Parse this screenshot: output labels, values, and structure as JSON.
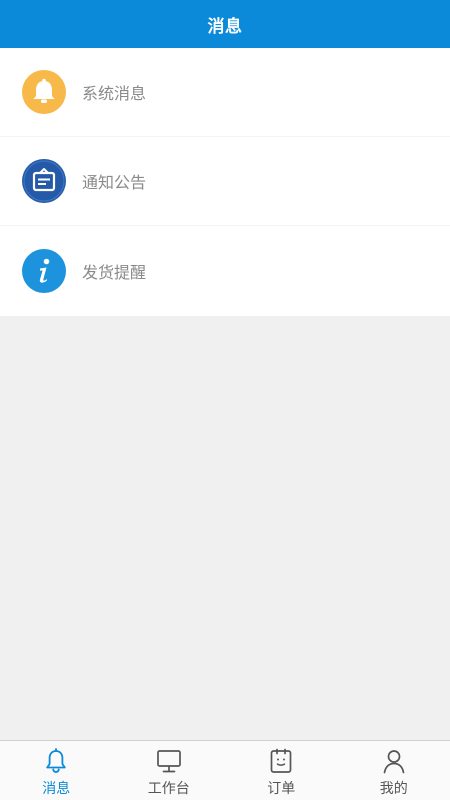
{
  "header": {
    "title": "消息",
    "color": "#0a8ad8"
  },
  "list": {
    "items": [
      {
        "label": "系统消息",
        "icon": "bell-icon",
        "icon_color": "#f7b94a"
      },
      {
        "label": "通知公告",
        "icon": "notice-board-icon",
        "icon_color": "#245aa7"
      },
      {
        "label": "发货提醒",
        "icon": "info-icon",
        "icon_color": "#1c93dc"
      }
    ]
  },
  "tabbar": {
    "active_color": "#0a8ad8",
    "inactive_color": "#555555",
    "tabs": [
      {
        "label": "消息",
        "icon": "bell-outline-icon",
        "active": true
      },
      {
        "label": "工作台",
        "icon": "monitor-icon",
        "active": false
      },
      {
        "label": "订单",
        "icon": "order-icon",
        "active": false
      },
      {
        "label": "我的",
        "icon": "user-icon",
        "active": false
      }
    ]
  }
}
